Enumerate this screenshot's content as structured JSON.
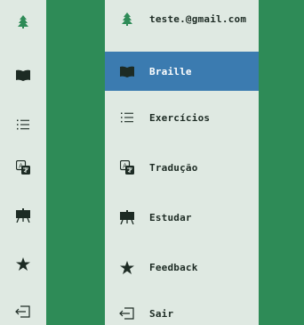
{
  "colors": {
    "green_bg": "#2e8b57",
    "panel_bg": "#dfe9e2",
    "active_bg": "#3b7bb0",
    "text": "#1d2b24"
  },
  "account": {
    "email": "teste.@gmail.com",
    "avatar_icon": "tree-logo-icon"
  },
  "menu": {
    "items": [
      {
        "label": "Braille",
        "icon": "book-icon",
        "active": true
      },
      {
        "label": "Exercícios",
        "icon": "list-icon",
        "active": false
      },
      {
        "label": "Tradução",
        "icon": "translate-icon",
        "active": false
      },
      {
        "label": "Estudar",
        "icon": "easel-icon",
        "active": false
      },
      {
        "label": "Feedback",
        "icon": "star-icon",
        "active": false
      },
      {
        "label": "Sair",
        "icon": "logout-icon",
        "active": false
      }
    ]
  }
}
